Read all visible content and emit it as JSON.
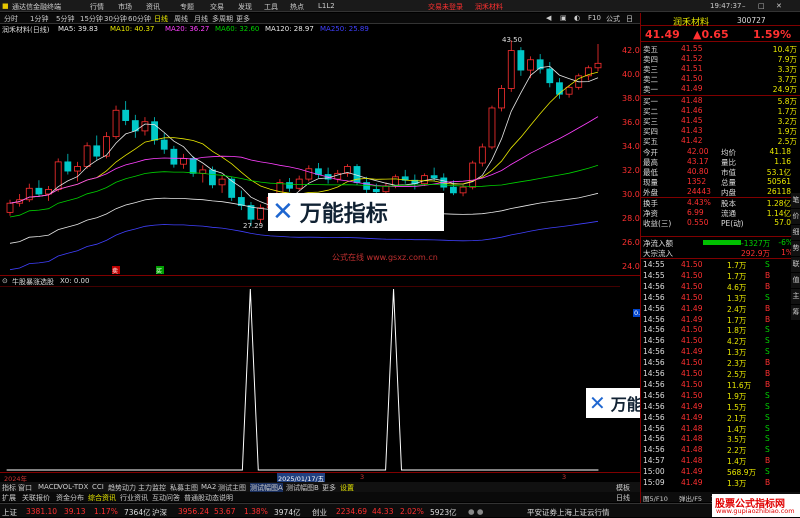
{
  "app": {
    "title": "通达信金融终端",
    "menus": [
      "行情",
      "市场",
      "资讯",
      "专题",
      "交易",
      "发现",
      "工具",
      "热点",
      "L1L2"
    ],
    "trade_login": "交易未登录",
    "stock_name_tb": "润禾材料",
    "time": "19:47:37",
    "f10": "F10",
    "btns": [
      "公式",
      "日"
    ]
  },
  "periods": [
    "分时",
    "1分钟",
    "5分钟",
    "15分钟",
    "30分钟",
    "60分钟",
    "日线",
    "周线",
    "月线",
    "多周期",
    "更多"
  ],
  "stock": {
    "title": "润禾材料(日线)",
    "name": "润禾材料",
    "code": "300727",
    "price": "41.49",
    "change": "▲0.65",
    "pct": "1.59%"
  },
  "ma": [
    {
      "label": "MA5: 39.83",
      "color": "#e8e8e8"
    },
    {
      "label": "MA10: 40.37",
      "color": "#e8e800"
    },
    {
      "label": "MA20: 36.27",
      "color": "#ff40ff"
    },
    {
      "label": "MA60: 32.60",
      "color": "#00d000"
    },
    {
      "label": "MA120: 28.97",
      "color": "#e8e8e8"
    },
    {
      "label": "MA250: 25.89",
      "color": "#4040ff"
    }
  ],
  "yaxis": [
    "42.00",
    "40.00",
    "38.00",
    "36.00",
    "34.00",
    "32.00",
    "30.00",
    "28.00",
    "26.00",
    "24.00"
  ],
  "chart_annot": {
    "high": "43.50",
    "low": "27.29",
    "watermark_url": "公式在线 www.gsxz.com.cn",
    "brand": "万能指标",
    "buy": "买",
    "sell": "卖"
  },
  "indicator": {
    "title": "牛股暴涨选股",
    "value": "X0: 0.00",
    "axis_value": "0.83"
  },
  "dates": {
    "year": "2024年",
    "cursor": "2025/01/17/五",
    "mark1": "3",
    "mark2": "3"
  },
  "tabs": [
    "指标",
    "窗口",
    "MACD",
    "VOL-TDX",
    "CCI",
    "趋势动力",
    "主力监控",
    "私募主图",
    "MA2",
    "测试主图",
    "测试幅图A",
    "测试幅图B",
    "更多",
    "设置"
  ],
  "tabs2": [
    "扩展",
    "关联报价",
    "资金分布",
    "综合资讯",
    "行业资讯",
    "互动问答",
    "普通股动态说明"
  ],
  "tabs_right": [
    "模板",
    "日线"
  ],
  "orderbook": {
    "sell": [
      {
        "l": "卖五",
        "p": "41.55",
        "v": "10.4万"
      },
      {
        "l": "卖四",
        "p": "41.52",
        "v": "7.9万"
      },
      {
        "l": "卖三",
        "p": "41.51",
        "v": "3.3万"
      },
      {
        "l": "卖二",
        "p": "41.50",
        "v": "3.7万"
      },
      {
        "l": "卖一",
        "p": "41.49",
        "v": "24.9万"
      }
    ],
    "buy": [
      {
        "l": "买一",
        "p": "41.48",
        "v": "5.8万"
      },
      {
        "l": "买二",
        "p": "41.46",
        "v": "1.7万"
      },
      {
        "l": "买三",
        "p": "41.45",
        "v": "3.2万"
      },
      {
        "l": "买四",
        "p": "41.43",
        "v": "1.9万"
      },
      {
        "l": "买五",
        "p": "41.42",
        "v": "2.5万"
      }
    ]
  },
  "stats": [
    [
      "今开",
      "42.00",
      "均价",
      "41.18"
    ],
    [
      "最高",
      "43.17",
      "量比",
      "1.16"
    ],
    [
      "最低",
      "40.80",
      "市值",
      "53.1亿"
    ],
    [
      "现量",
      "1352",
      "总量",
      "50561"
    ],
    [
      "外盘",
      "24443",
      "内盘",
      "26118"
    ],
    [
      "换手",
      "4.43%",
      "股本",
      "1.28亿"
    ],
    [
      "净资",
      "6.99",
      "流通",
      "1.14亿"
    ],
    [
      "收益(三)",
      "0.550",
      "PE(动)",
      "57.0"
    ]
  ],
  "flows": [
    {
      "l": "净流入额",
      "v": "-1327万",
      "p": "-6%"
    },
    {
      "l": "大宗流入",
      "v": "292.9万",
      "p": "1%"
    }
  ],
  "ticks": [
    [
      "14:55",
      "41.50",
      "1.7万",
      "S"
    ],
    [
      "14:55",
      "41.50",
      "1.7万",
      "B"
    ],
    [
      "14:56",
      "41.50",
      "4.6万",
      "B"
    ],
    [
      "14:56",
      "41.50",
      "1.3万",
      "S"
    ],
    [
      "14:56",
      "41.49",
      "2.4万",
      "B"
    ],
    [
      "14:56",
      "41.49",
      "1.7万",
      "B"
    ],
    [
      "14:56",
      "41.50",
      "1.8万",
      "S"
    ],
    [
      "14:56",
      "41.50",
      "4.2万",
      "S"
    ],
    [
      "14:56",
      "41.49",
      "1.3万",
      "S"
    ],
    [
      "14:56",
      "41.50",
      "2.3万",
      "B"
    ],
    [
      "14:56",
      "41.50",
      "2.5万",
      "B"
    ],
    [
      "14:56",
      "41.50",
      "11.6万",
      "B"
    ],
    [
      "14:56",
      "41.50",
      "1.9万",
      "S"
    ],
    [
      "14:56",
      "41.49",
      "1.5万",
      "S"
    ],
    [
      "14:56",
      "41.49",
      "2.1万",
      "S"
    ],
    [
      "14:56",
      "41.48",
      "1.4万",
      "S"
    ],
    [
      "14:56",
      "41.48",
      "3.5万",
      "S"
    ],
    [
      "14:56",
      "41.48",
      "2.2万",
      "S"
    ],
    [
      "14:57",
      "41.48",
      "1.4万",
      "B"
    ],
    [
      "15:00",
      "41.49",
      "568.9万",
      "S"
    ],
    [
      "15:09",
      "41.49",
      "1.3万",
      "B"
    ]
  ],
  "rp_tabs": [
    "笔",
    "价",
    "细",
    "势",
    "联",
    "值",
    "主",
    "筹"
  ],
  "rp_bottom": [
    "图5/F10",
    "弹出/F5",
    "更多"
  ],
  "status": {
    "sh": "上证",
    "sh_val": "3381.10",
    "sh_chg": "39.13",
    "sh_pct": "1.17%",
    "sh_amt": "7364亿",
    "sz": "沪深",
    "sz_val": "3956.24",
    "sz_chg": "53.67",
    "sz_pct": "1.38%",
    "sz_amt": "3974亿",
    "cy": "创业",
    "cy_val": "2234.69",
    "cy_chg": "44.33",
    "cy_pct": "2.02%",
    "cy_amt": "5923亿",
    "broker": "平安证券上海上证云行情",
    "site": "股票公式指标网",
    "site_url": "www.gupiaozhibiao.com"
  }
}
